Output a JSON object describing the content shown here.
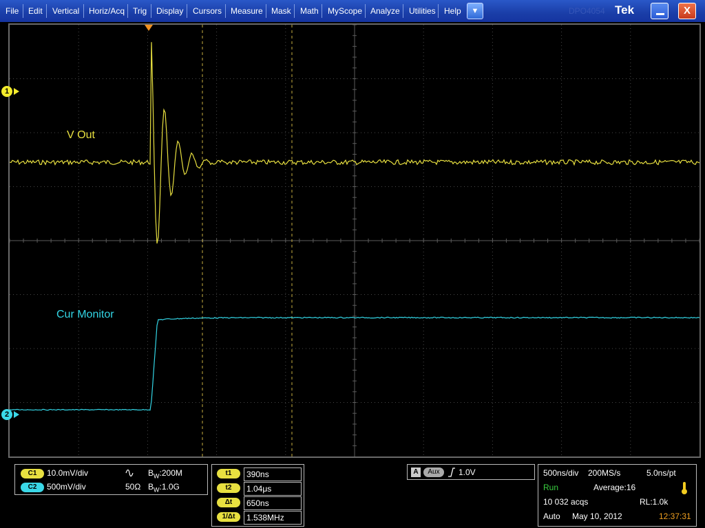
{
  "menubar": {
    "items": [
      "File",
      "Edit",
      "Vertical",
      "Horiz/Acq",
      "Trig",
      "Display",
      "Cursors",
      "Measure",
      "Mask",
      "Math",
      "MyScope",
      "Analyze",
      "Utilities",
      "Help"
    ],
    "dropdown_glyph": "▼",
    "faded_text": "DPO4054",
    "brand": "Tek",
    "close_glyph": "X"
  },
  "waveforms": {
    "ch1_label": "V Out",
    "ch2_label": "Cur Monitor",
    "ch1_marker": "1",
    "ch2_marker": "2",
    "ch1_color": "#e8e040",
    "ch2_color": "#33d6e6"
  },
  "channels": {
    "c1": {
      "tag": "C1",
      "scale": "10.0mV/div",
      "coupling_icon": "ac-coupling-icon",
      "bw": "200M"
    },
    "c2": {
      "tag": "C2",
      "scale": "500mV/div",
      "impedance": "50Ω",
      "bw": "1.0G"
    },
    "bw_prefix": "B",
    "bw_sub": "W",
    "bw_sep": ":"
  },
  "cursors": [
    {
      "tag": "t1",
      "value": "390ns"
    },
    {
      "tag": "t2",
      "value": "1.04μs"
    },
    {
      "tag": "Δt",
      "value": "650ns"
    },
    {
      "tag": "1/Δt",
      "value": "1.538MHz"
    }
  ],
  "trigger": {
    "source_tag": "A",
    "source": "Aux",
    "slope_icon": "rising-edge-icon",
    "level": "1.0V"
  },
  "acquisition": {
    "timebase": "500ns/div",
    "sample_rate": "200MS/s",
    "resolution": "5.0ns/pt",
    "state": "Run",
    "mode": "Average:16",
    "acqs": "10 032 acqs",
    "record_length": "RL:1.0k",
    "trigger_mode": "Auto",
    "date": "May 10, 2012",
    "time": "12:37:31",
    "state_color": "#3ad040",
    "time_color": "#f0a020"
  }
}
